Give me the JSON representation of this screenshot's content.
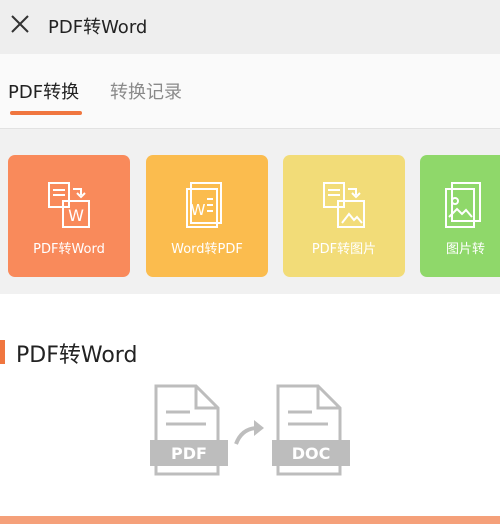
{
  "header": {
    "title": "PDF转Word"
  },
  "tabs": [
    {
      "label": "PDF转换",
      "active": true
    },
    {
      "label": "转换记录",
      "active": false
    }
  ],
  "tools": [
    {
      "label": "PDF转Word",
      "icon": "pdf-to-word-icon",
      "color": "#f98a5b"
    },
    {
      "label": "Word转PDF",
      "icon": "word-to-pdf-icon",
      "color": "#fbbc4e"
    },
    {
      "label": "PDF转图片",
      "icon": "pdf-to-image-icon",
      "color": "#f2dc78"
    },
    {
      "label": "图片转",
      "icon": "image-to-pdf-icon",
      "color": "#8fd86a"
    }
  ],
  "section": {
    "title": "PDF转Word",
    "from_label": "PDF",
    "to_label": "DOC"
  },
  "colors": {
    "accent": "#f0763f"
  }
}
